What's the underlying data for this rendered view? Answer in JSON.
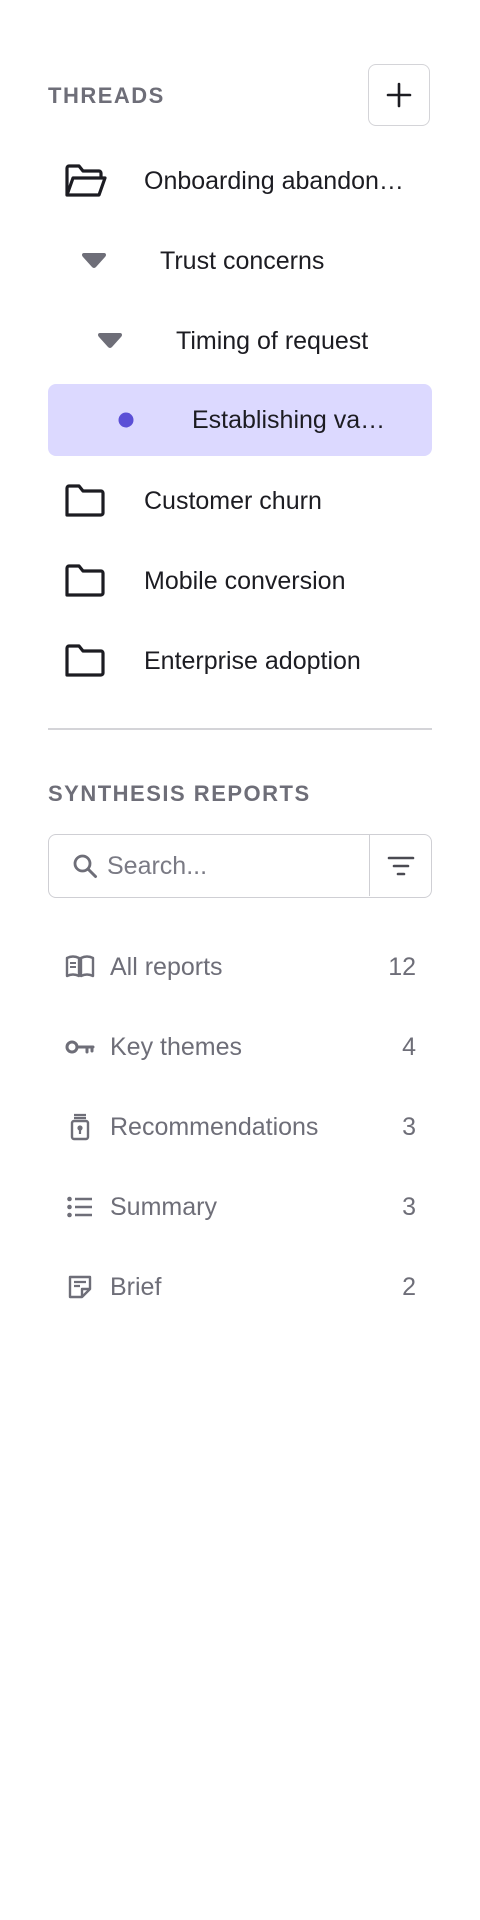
{
  "threads": {
    "header": "THREADS",
    "items": [
      {
        "label": "Onboarding abandon…",
        "icon": "folder-open-icon"
      },
      {
        "label": "Trust concerns",
        "icon": "caret-down-icon"
      },
      {
        "label": "Timing of request",
        "icon": "caret-down-icon"
      },
      {
        "label": "Establishing va…",
        "icon": "dot-icon",
        "selected": true
      },
      {
        "label": "Customer churn",
        "icon": "folder-icon"
      },
      {
        "label": "Mobile conversion",
        "icon": "folder-icon"
      },
      {
        "label": "Enterprise adoption",
        "icon": "folder-icon"
      }
    ]
  },
  "reports": {
    "header": "SYNTHESIS REPORTS",
    "search_placeholder": "Search...",
    "items": [
      {
        "label": "All reports",
        "count": "12",
        "icon": "book-open-icon"
      },
      {
        "label": "Key themes",
        "count": "4",
        "icon": "key-icon"
      },
      {
        "label": "Recommendations",
        "count": "3",
        "icon": "badge-icon"
      },
      {
        "label": "Summary",
        "count": "3",
        "icon": "list-icon"
      },
      {
        "label": "Brief",
        "count": "2",
        "icon": "note-icon"
      }
    ]
  },
  "colors": {
    "accent": "#5b4fd6",
    "selected_bg": "#dcd9ff",
    "muted_text": "#6e6e78"
  }
}
